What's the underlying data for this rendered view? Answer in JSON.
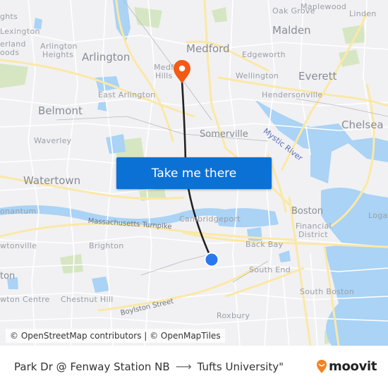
{
  "map": {
    "labels": {
      "oak_grove": "Oak Grove",
      "maplewood": "Maplewood",
      "linden": "Linden",
      "malden": "Malden",
      "medford": "Medford",
      "edgeworth": "Edgeworth",
      "wellington": "Wellington",
      "everett": "Everett",
      "hendersonville": "Hendersonville",
      "chelsea": "Chelsea",
      "mystic_river": "Mystic River",
      "somerville": "Somerville",
      "lexington": "Lexington",
      "heights": "ghts",
      "cumberland": "erland",
      "woods": "oods",
      "arlington_heights_1": "Arlington",
      "arlington_heights_2": "Heights",
      "arlington": "Arlington",
      "medford_hillside_1": "Medf",
      "medford_hillside_2": "Hills",
      "east_arlington": "East Arlington",
      "belmont": "Belmont",
      "waverley": "Waverley",
      "watertown": "Watertown",
      "nonantum": "onantum",
      "mass_pike": "Massachusetts Turnpike",
      "cambridgeport": "Cambridgeport",
      "boston": "Boston",
      "financial_1": "Financial",
      "financial_2": "District",
      "logan": "Logan",
      "newtonville": "wtonville",
      "brighton": "Brighton",
      "back_bay": "Back Bay",
      "newton": "ton",
      "south_end": "South End",
      "newton_centre": "wton Centre",
      "chestnut_hill": "Chestnut Hill",
      "boylston": "Boylston Street",
      "south_boston": "South Boston",
      "roxbury": "Roxbury"
    },
    "origin_marker": "blue-dot",
    "destination_marker": "orange-pin",
    "colors": {
      "land": "#f1f1f3",
      "water": "#aad3f5",
      "park": "#cfe3b8",
      "major_road": "#fbe8a6",
      "minor_road": "#ffffff",
      "route_line": "#222222",
      "origin": "#2a79f0",
      "destination": "#f25a16"
    }
  },
  "cta": {
    "label": "Take me there",
    "color": "#0c71d5"
  },
  "attribution": "© OpenStreetMap contributors | © OpenMapTiles",
  "footer": {
    "origin": "Park Dr @ Fenway Station NB",
    "arrow": "⟶",
    "destination": "Tufts University\"",
    "brand": "moovit",
    "brand_color": "#f5821f"
  }
}
